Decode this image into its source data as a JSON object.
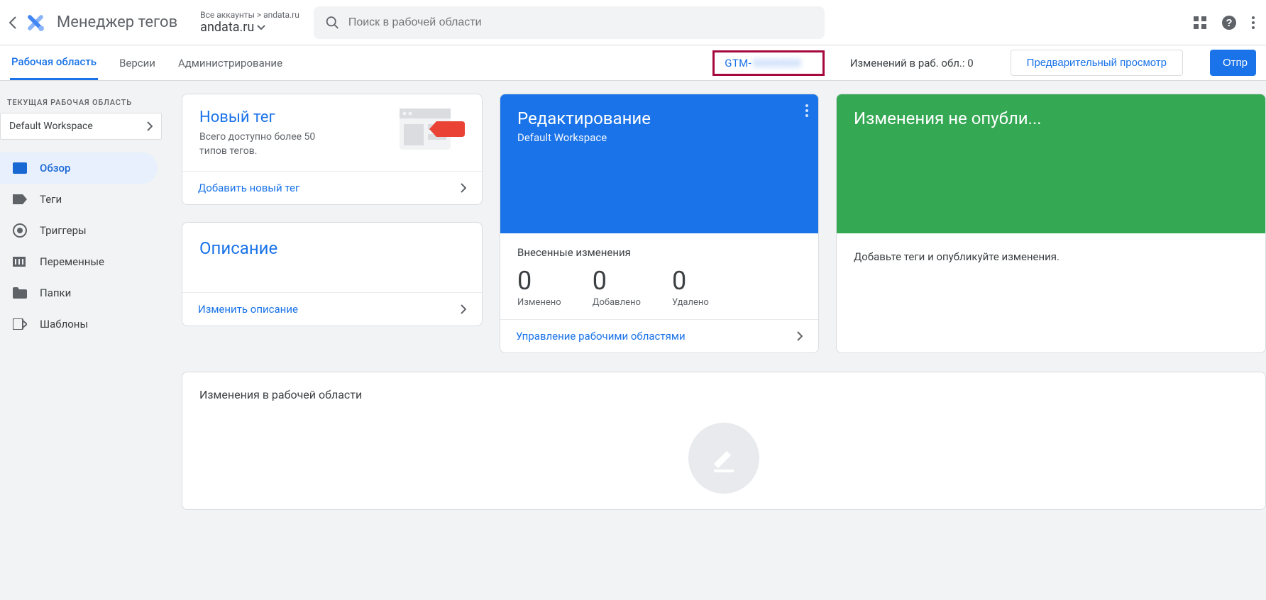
{
  "header": {
    "app_title": "Менеджер тегов",
    "account_path": "Все аккаунты > andata.ru",
    "account_name": "andata.ru",
    "search_placeholder": "Поиск в рабочей области"
  },
  "subbar": {
    "tabs": [
      "Рабочая область",
      "Версии",
      "Администрирование"
    ],
    "gtm_prefix": "GTM-",
    "gtm_rest": "XXXXXXX",
    "changes_label": "Изменений в раб. обл.: 0",
    "preview_btn": "Предварительный просмотр",
    "submit_btn": "Отпр"
  },
  "sidebar": {
    "section_title": "ТЕКУЩАЯ РАБОЧАЯ ОБЛАСТЬ",
    "workspace": "Default Workspace",
    "items": [
      {
        "label": "Обзор"
      },
      {
        "label": "Теги"
      },
      {
        "label": "Триггеры"
      },
      {
        "label": "Переменные"
      },
      {
        "label": "Папки"
      },
      {
        "label": "Шаблоны"
      }
    ]
  },
  "cards": {
    "new_tag": {
      "title": "Новый тег",
      "desc": "Всего доступно более 50 типов тегов.",
      "action": "Добавить новый тег"
    },
    "description": {
      "title": "Описание",
      "action": "Изменить описание"
    },
    "editing": {
      "title": "Редактирование",
      "sub": "Default Workspace",
      "changes_label": "Внесенные изменения",
      "stats": [
        {
          "num": "0",
          "lab": "Изменено"
        },
        {
          "num": "0",
          "lab": "Добавлено"
        },
        {
          "num": "0",
          "lab": "Удалено"
        }
      ],
      "action": "Управление рабочими областями"
    },
    "unpublished": {
      "title": "Изменения не опубли...",
      "body": "Добавьте теги и опубликуйте изменения."
    }
  },
  "workspace_changes": {
    "title": "Изменения в рабочей области"
  }
}
